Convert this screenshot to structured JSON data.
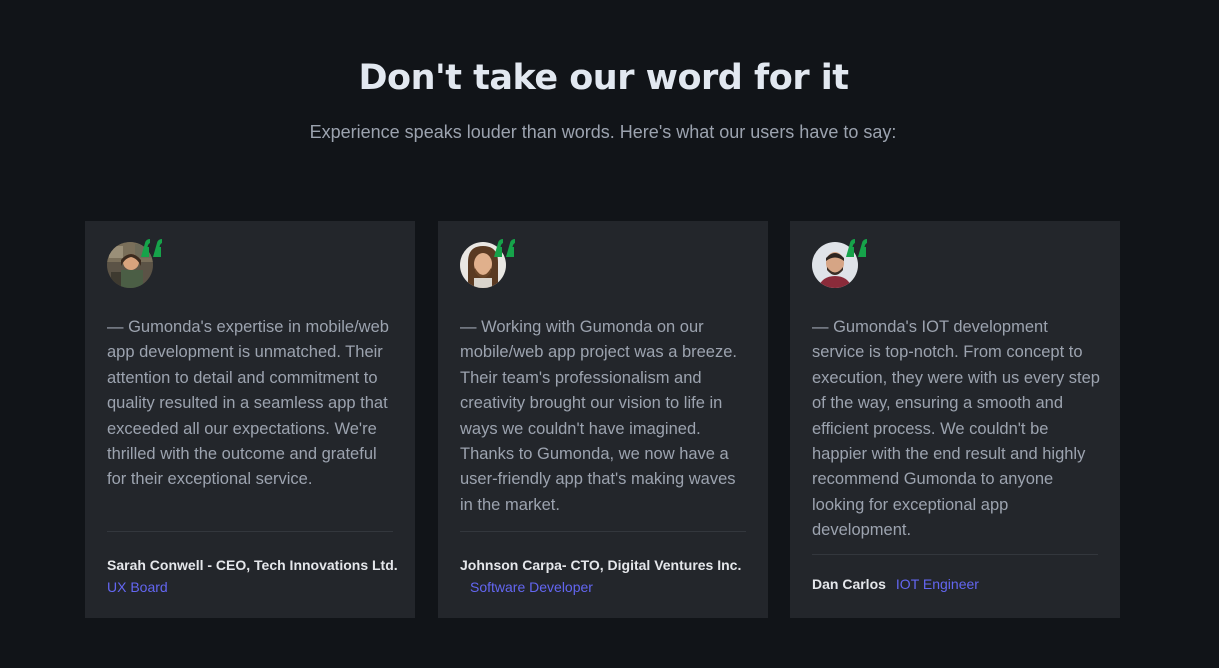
{
  "header": {
    "title": "Don't take our word for it",
    "subtitle": "Experience speaks louder than words. Here's what our users have to say:"
  },
  "colors": {
    "background": "#111418",
    "card": "#23262b",
    "quote_accent": "#16a34a",
    "role_accent": "#6366f1"
  },
  "testimonials": [
    {
      "quote": "— Gumonda's expertise in mobile/web app development is unmatched. Their attention to detail and commitment to quality resulted in a seamless app that exceeded all our expectations. We're thrilled with the outcome and grateful for their exceptional service.",
      "name": "Sarah Conwell - CEO, Tech Innovations Ltd.",
      "role": "UX Board",
      "avatar_icon": "avatar-photo",
      "quote_icon": "quote-icon"
    },
    {
      "quote": "— Working with Gumonda on our mobile/web app project was a breeze. Their team's professionalism and creativity brought our vision to life in ways we couldn't have imagined. Thanks to Gumonda, we now have a user-friendly app that's making waves in the market.",
      "name": "Johnson Carpa- CTO, Digital Ventures Inc.",
      "role": "Software Developer",
      "avatar_icon": "avatar-photo",
      "quote_icon": "quote-icon"
    },
    {
      "quote": "— Gumonda's IOT development service is top-notch. From concept to execution, they were with us every step of the way, ensuring a smooth and efficient process. We couldn't be happier with the end result and highly recommend Gumonda to anyone looking for exceptional app development.",
      "name": "Dan Carlos",
      "role": "IOT Engineer",
      "avatar_icon": "avatar-photo",
      "quote_icon": "quote-icon"
    }
  ]
}
